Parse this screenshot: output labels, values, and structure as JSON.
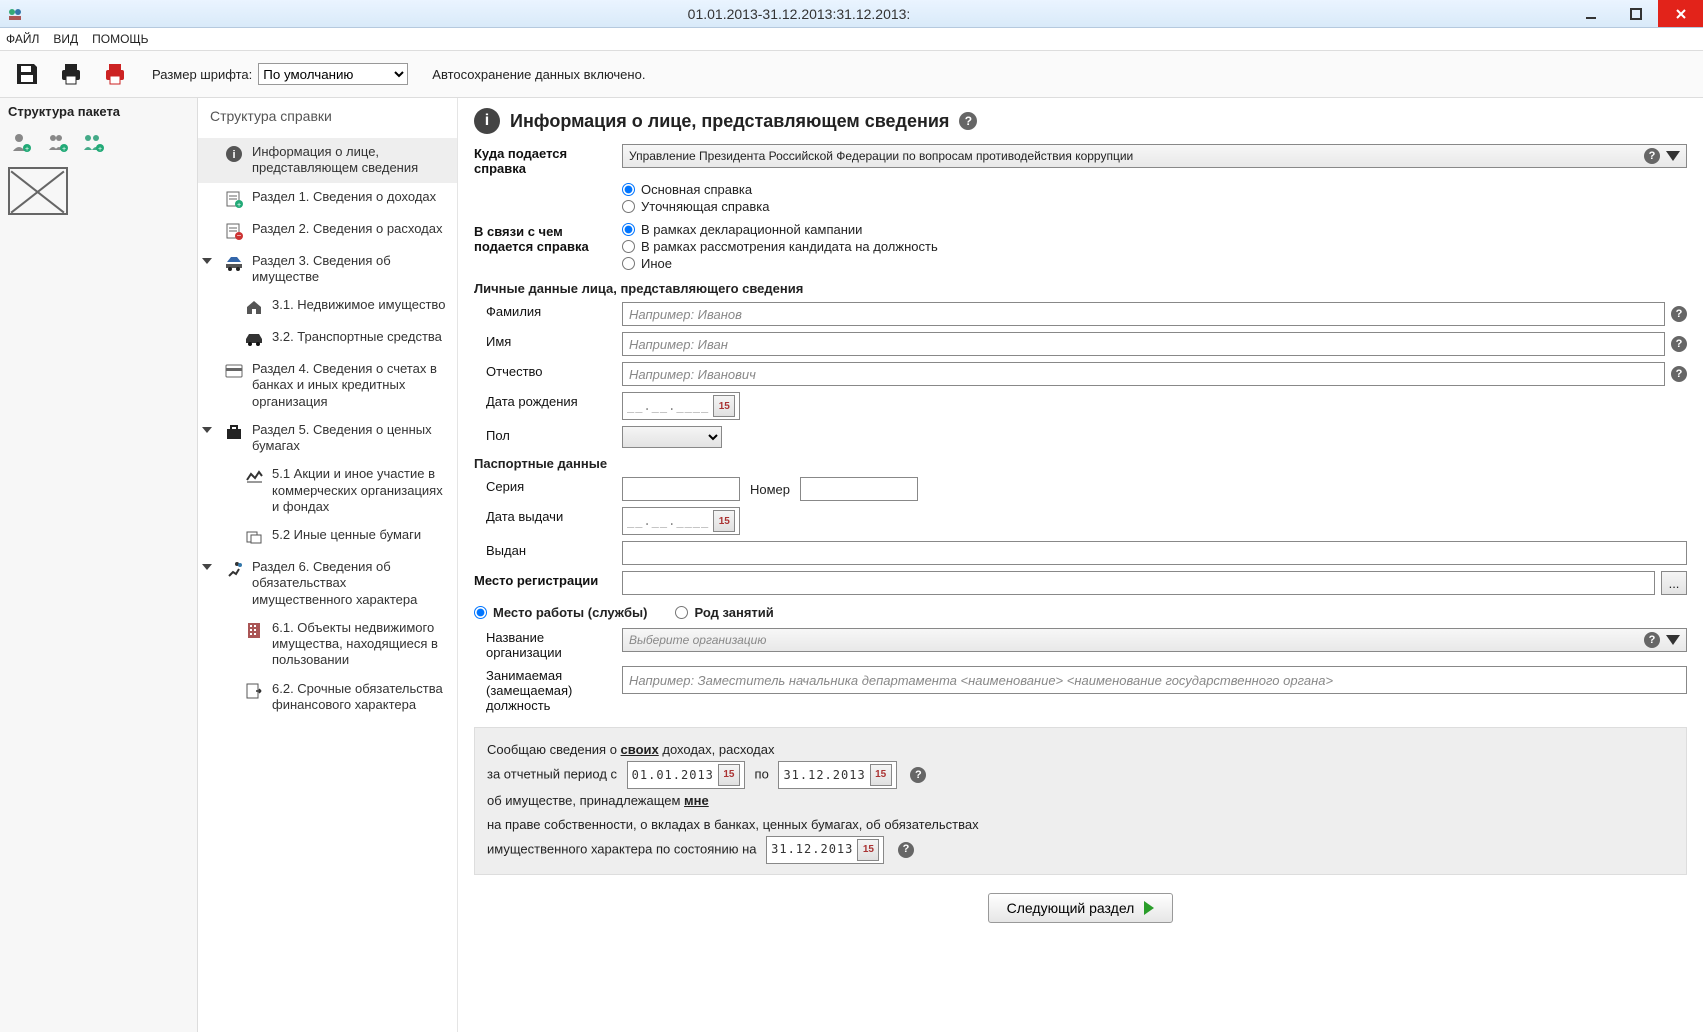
{
  "window": {
    "title": "01.01.2013-31.12.2013:31.12.2013:"
  },
  "menu": {
    "file": "ФАЙЛ",
    "view": "ВИД",
    "help": "ПОМОЩЬ"
  },
  "toolbar": {
    "font_label": "Размер шрифта:",
    "font_default": "По умолчанию",
    "autosave": "Автосохранение данных включено."
  },
  "pkg": {
    "title": "Структура пакета"
  },
  "nav": {
    "title": "Структура справки",
    "items": [
      {
        "label": "Информация о лице, представляющем сведения"
      },
      {
        "label": "Раздел 1. Сведения о доходах"
      },
      {
        "label": "Раздел 2. Сведения о расходах"
      },
      {
        "label": "Раздел 3. Сведения об имуществе"
      },
      {
        "label": "3.1. Недвижимое имущество"
      },
      {
        "label": "3.2. Транспортные средства"
      },
      {
        "label": "Раздел 4. Сведения о счетах в банках и иных кредитных организация"
      },
      {
        "label": "Раздел 5. Сведения о ценных бумагах"
      },
      {
        "label": "5.1 Акции и иное участие в коммерческих организациях и фондах"
      },
      {
        "label": "5.2 Иные ценные бумаги"
      },
      {
        "label": "Раздел 6. Сведения об обязательствах имущественного характера"
      },
      {
        "label": "6.1. Объекты недвижимого имущества, находящиеся в пользовании"
      },
      {
        "label": "6.2. Срочные обязательства финансового характера"
      }
    ]
  },
  "form": {
    "title": "Информация о лице, представляющем сведения",
    "dest_label": "Куда подается справка",
    "dest_value": "Управление Президента Российской Федерации по вопросам противодействия коррупции",
    "type_main": "Основная справка",
    "type_correct": "Уточняющая справка",
    "reason_label": "В связи с чем подается справка",
    "reason_campaign": "В рамках декларационной кампании",
    "reason_candidate": "В рамках рассмотрения кандидата на должность",
    "reason_other": "Иное",
    "personal_header": "Личные данные лица, представляющего сведения",
    "lastname_label": "Фамилия",
    "lastname_ph": "Например: Иванов",
    "firstname_label": "Имя",
    "firstname_ph": "Например: Иван",
    "midname_label": "Отчество",
    "midname_ph": "Например: Иванович",
    "dob_label": "Дата рождения",
    "date_mask": "__.__.____",
    "cal_num": "15",
    "gender_label": "Пол",
    "passport_header": "Паспортные данные",
    "series_label": "Серия",
    "number_label": "Номер",
    "issue_date_label": "Дата выдачи",
    "issued_by_label": "Выдан",
    "reg_label": "Место регистрации",
    "more_btn": "...",
    "tab_work": "Место работы (службы)",
    "tab_occupation": "Род занятий",
    "org_label": "Название организации",
    "org_ph": "Выберите организацию",
    "position_label_1": "Занимаемая",
    "position_label_2": "(замещаемая)",
    "position_label_3": "должность",
    "position_ph": "Например: Заместитель начальника департамента <наименование> <наименование государственного органа>",
    "summary_1a": "Сообщаю сведения о ",
    "summary_1b": "своих",
    "summary_1c": " доходах, расходах",
    "summary_2a": "за отчетный период с",
    "summary_date1": "01.01.2013",
    "summary_2b": "по",
    "summary_date2": "31.12.2013",
    "summary_3a": "об имуществе, принадлежащем ",
    "summary_3b": "мне",
    "summary_4": "на праве собственности, о вкладах в банках, ценных бумагах, об обязательствах",
    "summary_5a": "имущественного характера по состоянию на",
    "summary_date3": "31.12.2013",
    "next": "Следующий раздел"
  }
}
